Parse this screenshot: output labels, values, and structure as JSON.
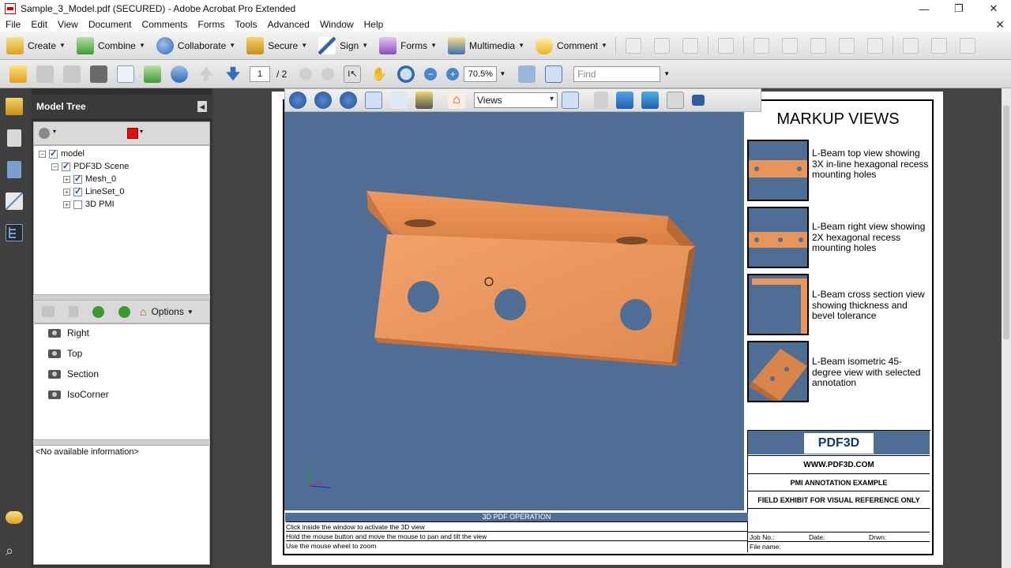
{
  "window": {
    "title": "Sample_3_Model.pdf (SECURED) - Adobe Acrobat Pro Extended",
    "controls": {
      "minimize": "—",
      "restore": "❐",
      "close": "✕"
    }
  },
  "menu": [
    "File",
    "Edit",
    "View",
    "Document",
    "Comments",
    "Forms",
    "Tools",
    "Advanced",
    "Window",
    "Help"
  ],
  "toolbar": {
    "create": "Create",
    "combine": "Combine",
    "collaborate": "Collaborate",
    "secure": "Secure",
    "sign": "Sign",
    "forms": "Forms",
    "multimedia": "Multimedia",
    "comment": "Comment"
  },
  "nav": {
    "page_current": "1",
    "page_total": "/ 2",
    "zoom": "70.5%",
    "find_placeholder": "Find"
  },
  "model_tree": {
    "title": "Model Tree",
    "nodes": [
      {
        "label": "model",
        "checked": true
      },
      {
        "label": "PDF3D Scene",
        "checked": true
      },
      {
        "label": "Mesh_0",
        "checked": true
      },
      {
        "label": "LineSet_0",
        "checked": true
      },
      {
        "label": "3D PMI",
        "checked": false
      }
    ],
    "options_label": "Options",
    "views": [
      "Right",
      "Top",
      "Section",
      "IsoCorner"
    ],
    "info": "<No available information>"
  },
  "toolbar3d": {
    "views_dropdown": "Views"
  },
  "document": {
    "markup_title": "MARKUP VIEWS",
    "views": [
      {
        "desc": "L-Beam top view showing 3X in-line hexagonal recess mounting holes"
      },
      {
        "desc": "L-Beam right view showing 2X hexagonal recess mounting holes"
      },
      {
        "desc": "L-Beam cross section view showing thickness and bevel tolerance"
      },
      {
        "desc": "L-Beam isometric 45-degree view with selected annotation"
      }
    ],
    "logo": "PDF3D",
    "website": "WWW.PDF3D.COM",
    "example": "PMI ANNOTATION EXAMPLE",
    "exhibit": "FIELD EXHIBIT FOR VISUAL REFERENCE ONLY",
    "operation_title": "3D PDF OPERATION",
    "operation_lines": [
      "Click inside the window to activate the 3D view",
      "Hold the mouse button and move the mouse to pan and tilt the view",
      "Use the mouse wheel to zoom"
    ],
    "job_no": "Job No.:",
    "date": "Date:",
    "drwn": "Drwn:",
    "file_name": "File name:"
  },
  "colors": {
    "accent_blue": "#4e6e96",
    "beam_orange": "#e8945a",
    "dark_chrome": "#3c3c3c"
  }
}
